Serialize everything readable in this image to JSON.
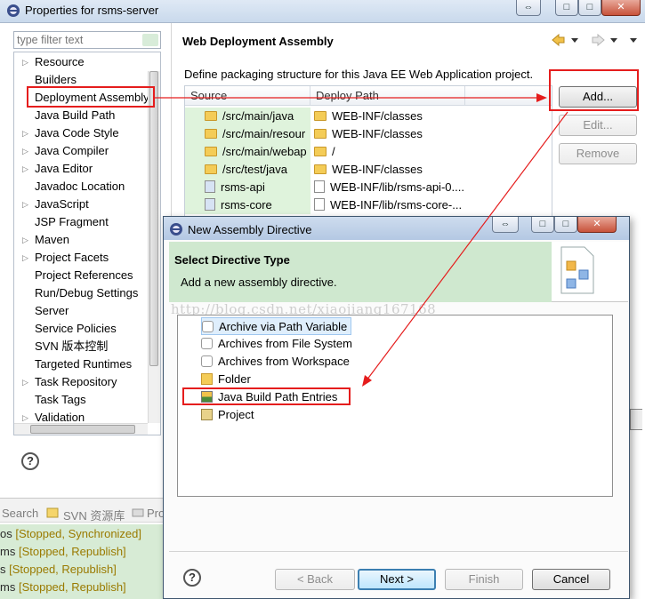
{
  "props_window": {
    "title": "Properties for rsms-server",
    "titlebar_buttons": [
      "⇔",
      "□",
      "✕"
    ],
    "filter_placeholder": "type filter text",
    "tree": [
      {
        "label": "Resource",
        "expandable": true
      },
      {
        "label": "Builders",
        "expandable": false
      },
      {
        "label": "Deployment Assembly",
        "expandable": false
      },
      {
        "label": "Java Build Path",
        "expandable": false
      },
      {
        "label": "Java Code Style",
        "expandable": true
      },
      {
        "label": "Java Compiler",
        "expandable": true
      },
      {
        "label": "Java Editor",
        "expandable": true
      },
      {
        "label": "Javadoc Location",
        "expandable": false
      },
      {
        "label": "JavaScript",
        "expandable": true
      },
      {
        "label": "JSP Fragment",
        "expandable": false
      },
      {
        "label": "Maven",
        "expandable": true
      },
      {
        "label": "Project Facets",
        "expandable": true
      },
      {
        "label": "Project References",
        "expandable": false
      },
      {
        "label": "Run/Debug Settings",
        "expandable": false
      },
      {
        "label": "Server",
        "expandable": false
      },
      {
        "label": "Service Policies",
        "expandable": false
      },
      {
        "label": "SVN 版本控制",
        "expandable": false
      },
      {
        "label": "Targeted Runtimes",
        "expandable": false
      },
      {
        "label": "Task Repository",
        "expandable": true
      },
      {
        "label": "Task Tags",
        "expandable": false
      },
      {
        "label": "Validation",
        "expandable": true
      }
    ],
    "page_title": "Web Deployment Assembly",
    "page_description": "Define packaging structure for this Java EE Web Application project.",
    "table": {
      "col_source": "Source",
      "col_deploy": "Deploy Path",
      "rows": [
        {
          "source": "/src/main/java",
          "deploy": "WEB-INF/classes",
          "kind": "folder"
        },
        {
          "source": "/src/main/resour",
          "deploy": "WEB-INF/classes",
          "kind": "folder"
        },
        {
          "source": "/src/main/webap",
          "deploy": "/",
          "kind": "folder"
        },
        {
          "source": "/src/test/java",
          "deploy": "WEB-INF/classes",
          "kind": "folder"
        },
        {
          "source": "rsms-api",
          "deploy": "WEB-INF/lib/rsms-api-0....",
          "kind": "project"
        },
        {
          "source": "rsms-core",
          "deploy": "WEB-INF/lib/rsms-core-...",
          "kind": "project"
        }
      ]
    },
    "buttons": {
      "add": "Add...",
      "edit": "Edit...",
      "remove": "Remove"
    },
    "help_glyph": "?"
  },
  "bottom_views": {
    "tabs": [
      "Search",
      "SVN 资源库",
      "Pro"
    ],
    "servers": [
      {
        "name": "os",
        "status": "[Stopped, Synchronized]"
      },
      {
        "name": "ms",
        "status": "[Stopped, Republish]"
      },
      {
        "name": "s",
        "status": "[Stopped, Republish]"
      },
      {
        "name": "ms",
        "status": "[Stopped, Republish]"
      }
    ]
  },
  "dialog": {
    "title": "New Assembly Directive",
    "titlebar_buttons": [
      "⇔",
      "□",
      "✕"
    ],
    "header_title": "Select Directive Type",
    "header_desc": "Add a new assembly directive.",
    "watermark": "http://blog.csdn.net/xiaojiang167168",
    "items": [
      {
        "label": "Archive via Path Variable",
        "icon": "jar-icon",
        "selected": true
      },
      {
        "label": "Archives from File System",
        "icon": "jar-icon",
        "selected": false
      },
      {
        "label": "Archives from Workspace",
        "icon": "jar-icon",
        "selected": false
      },
      {
        "label": "Folder",
        "icon": "folder-icon",
        "selected": false
      },
      {
        "label": "Java Build Path Entries",
        "icon": "library-icon",
        "selected": false
      },
      {
        "label": "Project",
        "icon": "project-icon",
        "selected": false
      }
    ],
    "buttons": {
      "back": "< Back",
      "next": "Next >",
      "finish": "Finish",
      "cancel": "Cancel"
    },
    "help_glyph": "?"
  },
  "colors": {
    "highlight_red": "#e51d1d",
    "source_cell_bg": "#dff3dc",
    "banner_green": "#cfe8cf"
  }
}
